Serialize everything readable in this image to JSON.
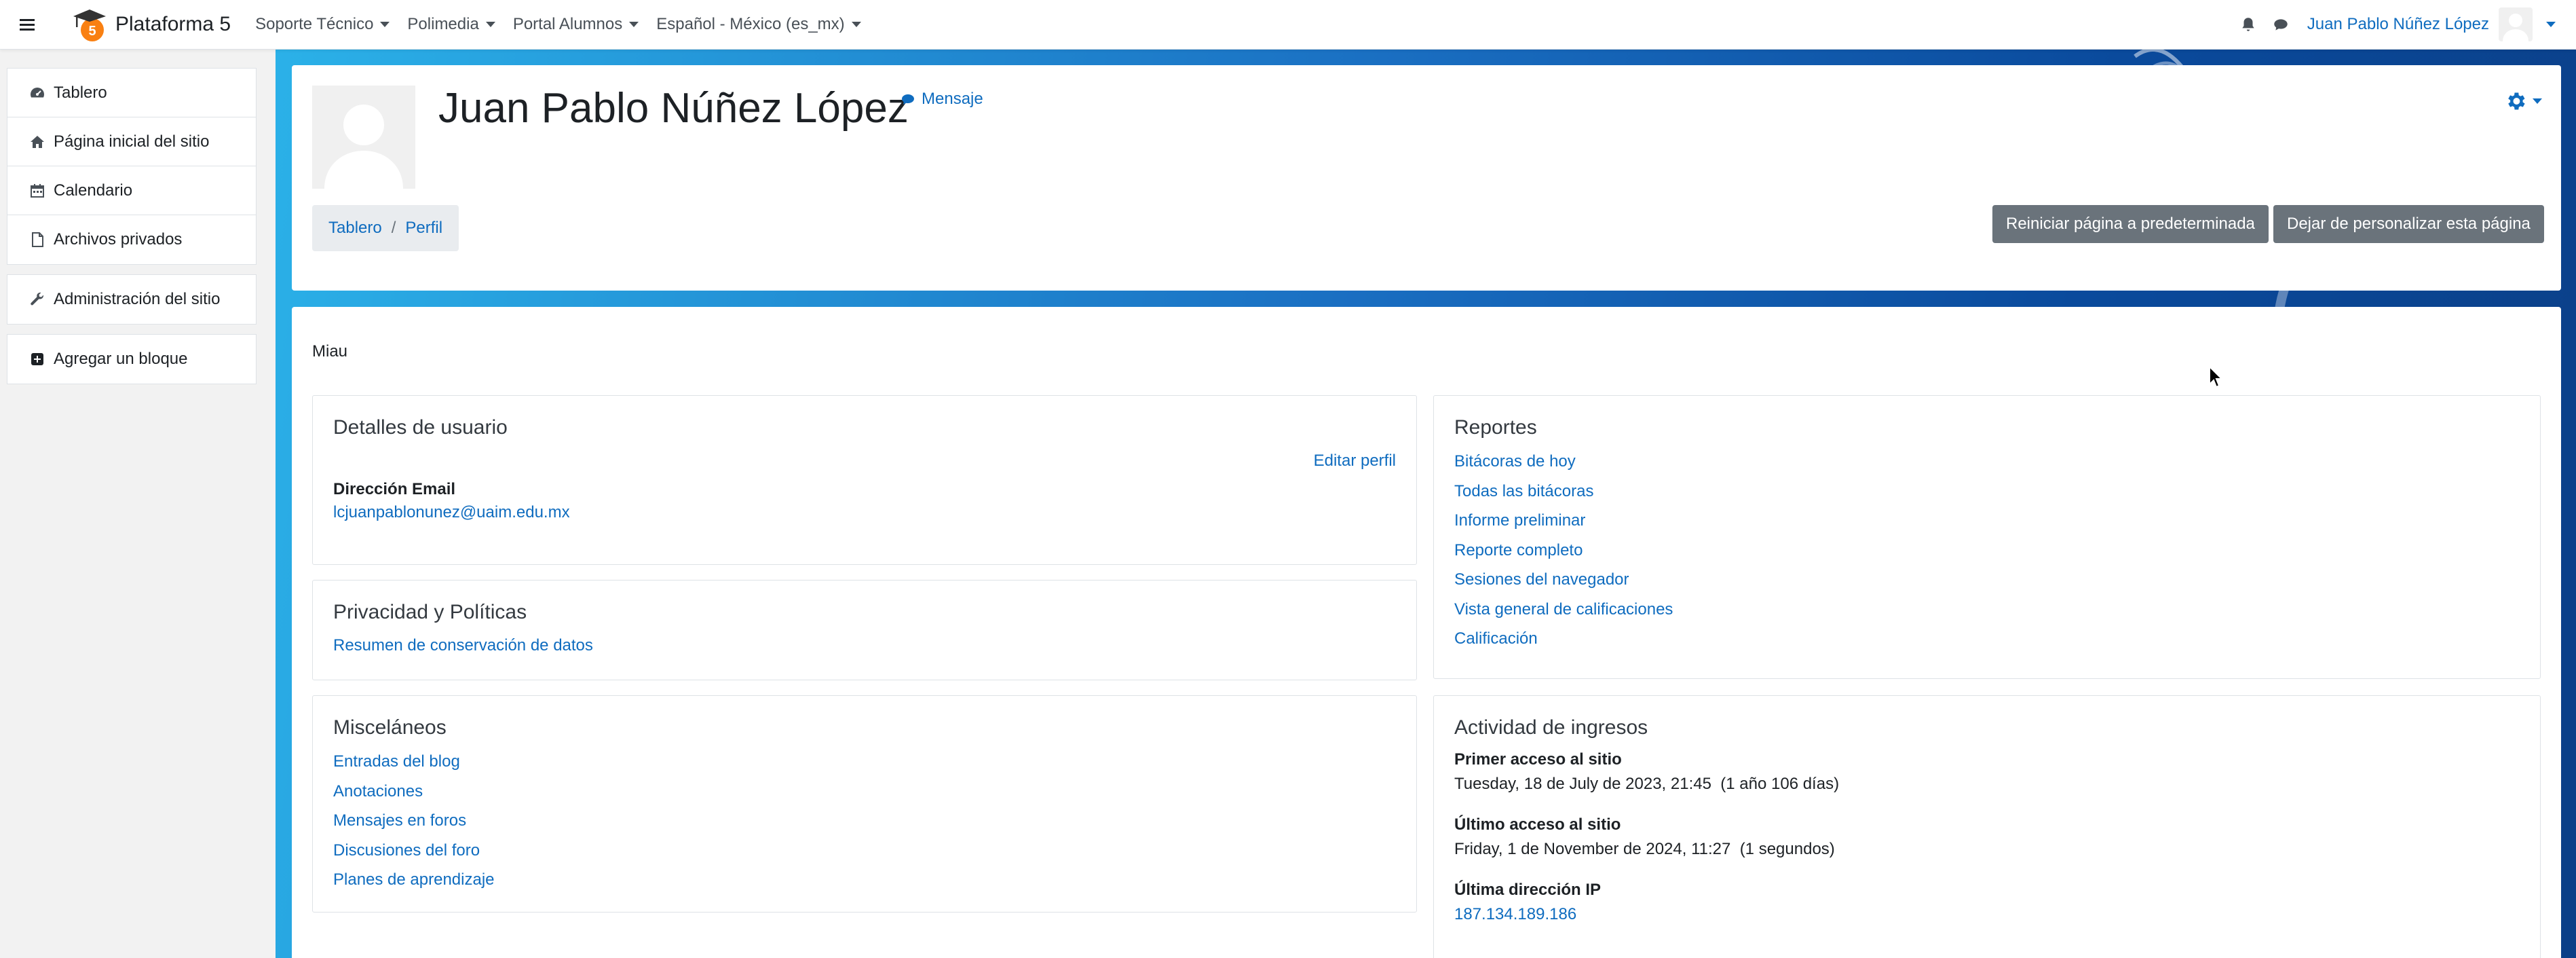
{
  "navbar": {
    "site_name": "Plataforma 5",
    "menu": [
      {
        "label": "Soporte Técnico"
      },
      {
        "label": "Polimedia"
      },
      {
        "label": "Portal Alumnos"
      },
      {
        "label": "Español - México (es_mx)"
      }
    ],
    "user_name": "Juan Pablo Núñez López"
  },
  "drawer": {
    "items": [
      {
        "label": "Tablero",
        "icon": "dashboard-icon"
      },
      {
        "label": "Página inicial del sitio",
        "icon": "home-icon"
      },
      {
        "label": "Calendario",
        "icon": "calendar-icon"
      },
      {
        "label": "Archivos privados",
        "icon": "file-icon"
      }
    ],
    "admin": {
      "label": "Administración del sitio",
      "icon": "wrench-icon"
    },
    "add_block": {
      "label": "Agregar un bloque",
      "icon": "plus-square-icon"
    }
  },
  "header": {
    "name": "Juan Pablo Núñez López",
    "message": "Mensaje",
    "breadcrumb": [
      "Tablero",
      "Perfil"
    ],
    "reset_button": "Reiniciar página a predeterminada",
    "stop_button": "Dejar de personalizar esta página"
  },
  "content": {
    "section_label": "Miau",
    "user_details": {
      "title": "Detalles de usuario",
      "edit": "Editar perfil",
      "email_label": "Dirección Email",
      "email": "lcjuanpablonunez@uaim.edu.mx"
    },
    "privacy": {
      "title": "Privacidad y Políticas",
      "link": "Resumen de conservación de datos"
    },
    "misc": {
      "title": "Misceláneos",
      "links": [
        "Entradas del blog",
        "Anotaciones",
        "Mensajes en foros",
        "Discusiones del foro",
        "Planes de aprendizaje"
      ]
    },
    "reports": {
      "title": "Reportes",
      "links": [
        "Bitácoras de hoy",
        "Todas las bitácoras",
        "Informe preliminar",
        "Reporte completo",
        "Sesiones del navegador",
        "Vista general de calificaciones",
        "Calificación"
      ]
    },
    "login_activity": {
      "title": "Actividad de ingresos",
      "first_label": "Primer acceso al sitio",
      "first_value": "Tuesday, 18 de July de 2023, 21:45  (1 año 106 días)",
      "last_label": "Último acceso al sitio",
      "last_value": "Friday, 1 de November de 2024, 11:27  (1 segundos)",
      "ip_label": "Última dirección IP",
      "ip_value": "187.134.189.186"
    }
  },
  "colors": {
    "link": "#0f6cbf",
    "button_secondary": "#6a737b",
    "logo_orange": "#f98012"
  }
}
